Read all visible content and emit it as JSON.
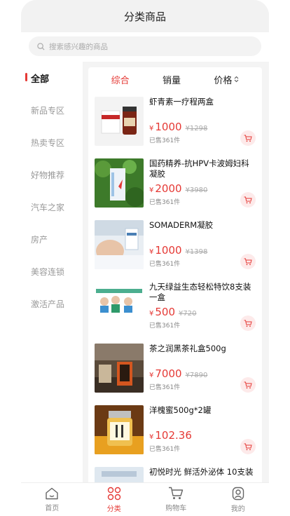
{
  "header": {
    "title": "分类商品"
  },
  "search": {
    "placeholder": "搜索感兴趣的商品"
  },
  "sidebar": {
    "items": [
      {
        "label": "全部",
        "active": true
      },
      {
        "label": "新品专区"
      },
      {
        "label": "热卖专区"
      },
      {
        "label": "好物推荐"
      },
      {
        "label": "汽车之家"
      },
      {
        "label": "房产"
      },
      {
        "label": "美容连锁"
      },
      {
        "label": "激活产品"
      }
    ]
  },
  "sort": {
    "composite": "综合",
    "sales": "销量",
    "price": "价格"
  },
  "currency_symbol": "¥",
  "products": [
    {
      "name": "虾青素一疗程两盒",
      "price": "1000",
      "original_price": "¥1298",
      "sold": "已售361件"
    },
    {
      "name": "国药精养-抗HPV卡波姆妇科凝胶",
      "price": "2000",
      "original_price": "¥3980",
      "sold": "已售361件"
    },
    {
      "name": "SOMADERM凝胶",
      "price": "1000",
      "original_price": "¥1398",
      "sold": "已售361件"
    },
    {
      "name": "九天绿益生态轻松特饮8支装一盒",
      "price": "500",
      "original_price": "¥720",
      "sold": "已售361件"
    },
    {
      "name": "茶之润黑茶礼盒500g",
      "price": "7000",
      "original_price": "¥7890",
      "sold": "已售361件"
    },
    {
      "name": "洋槐蜜500g*2罐",
      "price": "102.36",
      "original_price": "",
      "sold": "已售361件"
    },
    {
      "name": "初悦时光 鲜活外泌体 10支装",
      "price": "",
      "original_price": "",
      "sold": ""
    }
  ],
  "tabbar": {
    "home": "首页",
    "category": "分类",
    "cart": "购物车",
    "mine": "我的"
  },
  "colors": {
    "accent": "#e53935"
  }
}
